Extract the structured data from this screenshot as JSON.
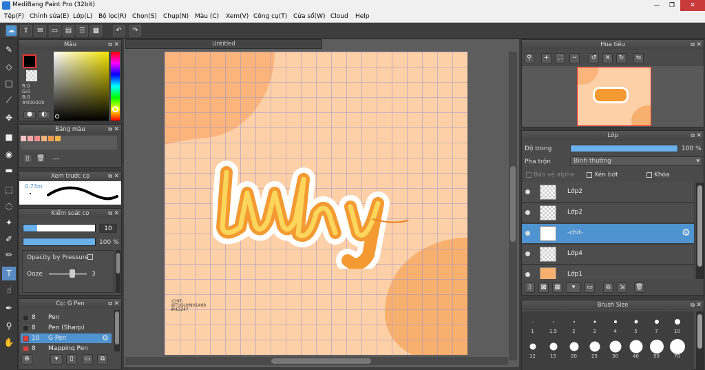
{
  "window": {
    "title": "MediBang Paint Pro (32bit)",
    "min": "—",
    "max": "❐",
    "close": "✕"
  },
  "menu": [
    "Tệp(F)",
    "Chỉnh sửa(E)",
    "Lớp(L)",
    "Bộ lọc(R)",
    "Chọn(S)",
    "Chụp(N)",
    "Màu (C)",
    "Xem(V)",
    "Công cụ(T)",
    "Cửa sổ(W)",
    "Cloud",
    "Help"
  ],
  "color_panel": {
    "title": "Màu",
    "r": "R:0",
    "g": "G:0",
    "b": "B:0",
    "hex": "#000000",
    "accent": "#5a8bc5"
  },
  "palette_panel": {
    "title": "Bảng màu",
    "list_text": "---",
    "swatches": [
      "#f4c2c2",
      "#f7a8a8",
      "#f58a8a",
      "#f3b27a",
      "#f39a4f",
      "#f2b24a"
    ]
  },
  "brush_preview": {
    "title": "Xem trước cọ",
    "size_label": "0.73m"
  },
  "brush_control": {
    "title": "Kiểm soát cọ",
    "size_value": "10",
    "opacity_value": "100 %",
    "opacity_pressure": "Opacity by Pressure",
    "ooze_label": "Ooze",
    "ooze_value": "3"
  },
  "pen_panel": {
    "title": "Cọ: G Pen",
    "items": [
      {
        "size": "8",
        "name": "Pen",
        "color": "#2a2a2a"
      },
      {
        "size": "8",
        "name": "Pen (Sharp)",
        "color": "#2a2a2a"
      },
      {
        "size": "10",
        "name": "G Pen",
        "color": "#e33c3c"
      },
      {
        "size": "8",
        "name": "Mapping Pen",
        "color": "#e33c3c"
      }
    ]
  },
  "document": {
    "tab": "Untitled",
    "signature": [
      "-CHIT-",
      "@TUQUYNH1409",
      "#HD247"
    ]
  },
  "navigator": {
    "title": "Hoa tiêu"
  },
  "layer_panel": {
    "title": "Lớp",
    "opacity_label": "Độ trong",
    "opacity_value": "100 %",
    "blend_label": "Pha trộn",
    "blend_value": "Bình thường",
    "protect_alpha": "Bảo vệ alpha",
    "clipping": "Xén bớt",
    "lock": "Khóa",
    "layers": [
      "Lớp2",
      "Lớp2",
      "-chit-",
      "Lớp4",
      "Lớp1"
    ]
  },
  "brush_size": {
    "title": "Brush Size",
    "sizes": [
      "1",
      "1.5",
      "2",
      "3",
      "4",
      "5",
      "7",
      "10",
      "12",
      "15",
      "20",
      "25",
      "30",
      "40",
      "50",
      "70"
    ]
  }
}
